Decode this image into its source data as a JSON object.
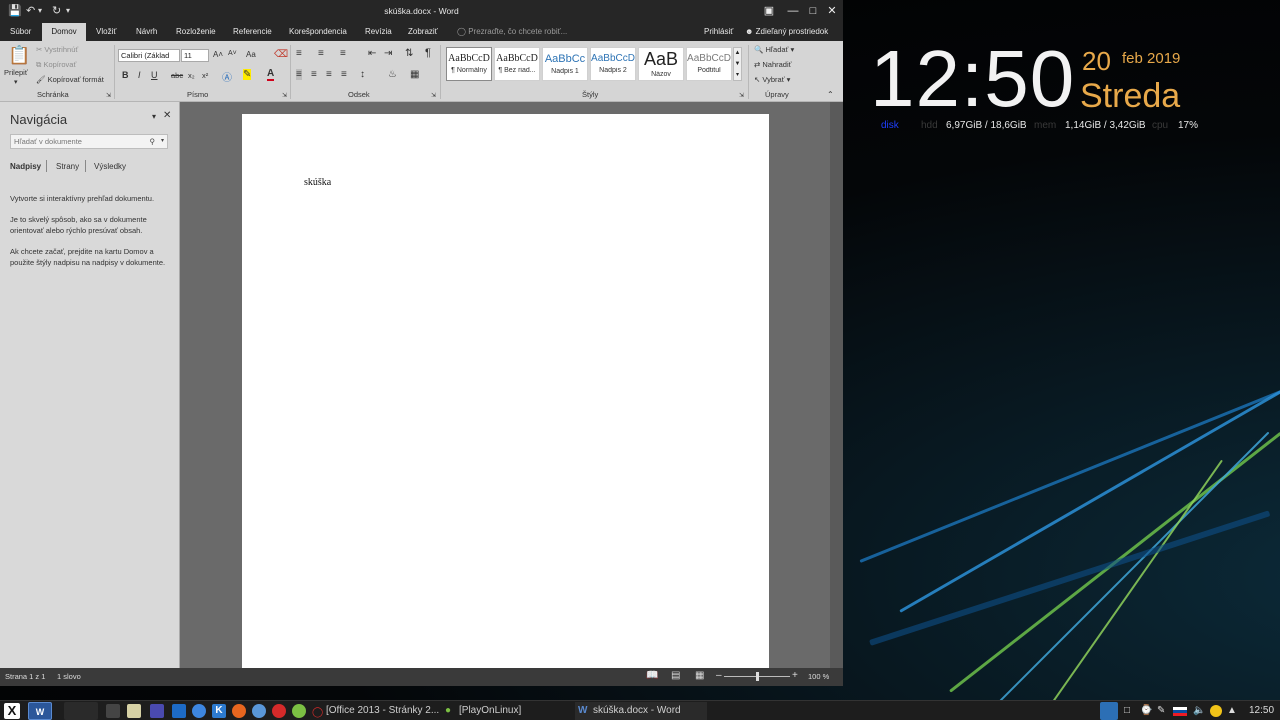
{
  "word": {
    "title": "skúška.docx - Word",
    "qat": {
      "save_icon": "save-icon",
      "undo_icon": "undo-icon",
      "redo_icon": "redo-icon"
    },
    "window_buttons": [
      "ribbon-display-icon",
      "minimize-icon",
      "maximize-icon",
      "close-icon"
    ],
    "tabs": [
      "Súbor",
      "Domov",
      "Vložiť",
      "Návrh",
      "Rozloženie",
      "Referencie",
      "Korešpondencia",
      "Revízia",
      "Zobraziť"
    ],
    "active_tab": "Domov",
    "tell_me": "Prezraďte, čo chcete robiť...",
    "sign_in": "Prihlásiť",
    "share": "Zdieľaný prostriedok",
    "clipboard": {
      "paste": "Prilepiť",
      "cut": "Vystrihnúť",
      "copy": "Kopírovať",
      "format_painter": "Kopírovať formát",
      "label": "Schránka"
    },
    "font": {
      "name": "Calibri (Základ",
      "size": "11",
      "grow": "A˄",
      "shrink": "A˅",
      "case": "Aa",
      "bold": "B",
      "italic": "I",
      "underline": "U",
      "strike": "abc",
      "subscript": "x₂",
      "superscript": "x²",
      "color_letter": "A",
      "label": "Písmo"
    },
    "paragraph": {
      "label": "Odsek",
      "pilcrow": "¶"
    },
    "styles": {
      "label": "Štýly",
      "items": [
        {
          "preview": "AaBbCcD",
          "name": "¶ Normálny"
        },
        {
          "preview": "AaBbCcD",
          "name": "¶ Bez riad..."
        },
        {
          "preview": "AaBbCc",
          "name": "Nadpis 1"
        },
        {
          "preview": "AaBbCcD",
          "name": "Nadpis 2"
        },
        {
          "preview": "AaB",
          "name": "Názov"
        },
        {
          "preview": "AaBbCcD",
          "name": "Podtitul"
        }
      ]
    },
    "editing": {
      "find": "Hľadať",
      "replace": "Nahradiť",
      "select": "Vybrať",
      "label": "Úpravy"
    },
    "nav": {
      "title": "Navigácia",
      "search_placeholder": "Hľadať v dokumente",
      "tabs": [
        "Nadpisy",
        "Strany",
        "Výsledky"
      ],
      "p1": "Vytvorte si interaktívny prehľad dokumentu.",
      "p2": "Je to skvelý spôsob, ako sa v dokumente orientovať alebo rýchlo presúvať obsah.",
      "p3": "Ak chcete začať, prejdite na kartu Domov a použite štýly nadpisu na nadpisy v dokumente."
    },
    "document": {
      "text": "skúška"
    },
    "status": {
      "page": "Strana 1 z 1",
      "words": "1 slovo",
      "zoom": "100 %",
      "zoom_level": 0.5
    }
  },
  "conky": {
    "time": "12:50",
    "day": "20",
    "month": "feb 2019",
    "weekday": "Streda",
    "stats": [
      {
        "label": "disk",
        "value": ""
      },
      {
        "label": "hdd",
        "value": "6,97GiB / 18,6GiB"
      },
      {
        "label": "mem",
        "value": "1,14GiB / 3,42GiB"
      },
      {
        "label": "cpu",
        "value": "17%"
      }
    ]
  },
  "taskbar": {
    "tasks": [
      "[Office 2013 - Stránky 2...",
      "[PlayOnLinux]",
      "skúška.docx - Word"
    ],
    "clock": "12:50"
  }
}
